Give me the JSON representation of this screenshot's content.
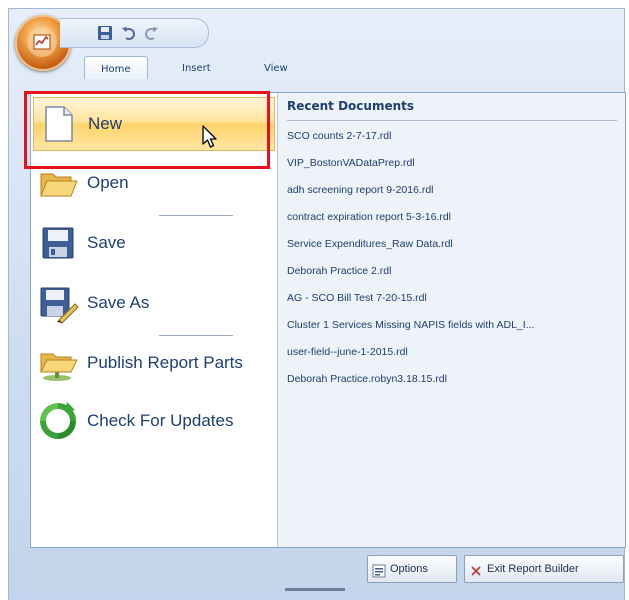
{
  "ribbon": {
    "tabs": [
      {
        "label": "Home",
        "active": true
      },
      {
        "label": "Insert",
        "active": false
      },
      {
        "label": "View",
        "active": false
      }
    ],
    "quick_access": {
      "icons": [
        "save-icon",
        "undo-icon",
        "redo-icon"
      ]
    }
  },
  "menu": {
    "items": [
      {
        "label": "New",
        "icon": "new-document-icon",
        "hover": true
      },
      {
        "label": "Open",
        "icon": "open-folder-icon"
      },
      {
        "label": "Save",
        "icon": "save-icon"
      },
      {
        "label": "Save As",
        "icon": "save-as-icon"
      },
      {
        "label": "Publish Report Parts",
        "icon": "publish-report-parts-icon"
      },
      {
        "label": "Check For Updates",
        "icon": "check-updates-icon"
      }
    ]
  },
  "recent": {
    "header": "Recent Documents",
    "items": [
      "SCO counts 2-7-17.rdl",
      "VIP_BostonVADataPrep.rdl",
      "adh screening report 9-2016.rdl",
      "contract expiration report 5-3-16.rdl",
      "Service Expenditures_Raw Data.rdl",
      "Deborah Practice 2.rdl",
      "AG - SCO Bill Test 7-20-15.rdl",
      "Cluster 1 Services Missing NAPIS fields with ADL_I...",
      "user-field--june-1-2015.rdl",
      "Deborah Practice.robyn3.18.15.rdl"
    ]
  },
  "footer": {
    "options_label": "Options",
    "exit_label": "Exit Report Builder"
  },
  "colors": {
    "accent_text": "#1f3f70",
    "highlight": "#e8101a",
    "hover_fill": "#ffe39a"
  }
}
